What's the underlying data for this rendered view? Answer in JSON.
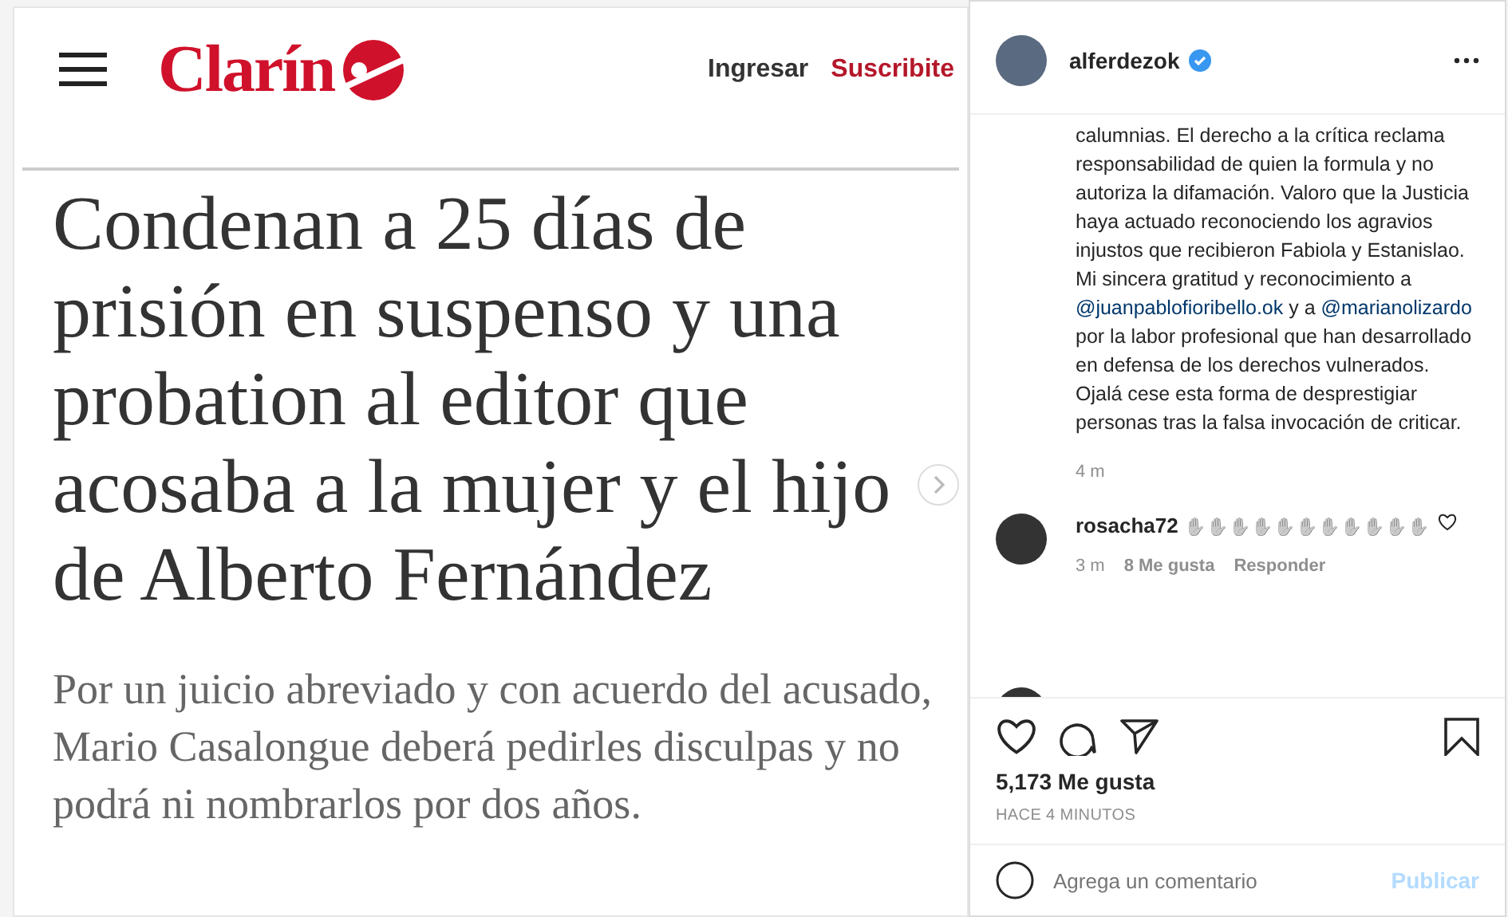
{
  "article": {
    "logo": "Clarín",
    "login": "Ingresar",
    "subscribe": "Suscribite",
    "headline": "Condenan a 25 días de prisión en suspenso y una probation al editor que acosaba a la mujer y el hijo de Alberto Fernández",
    "summary": "Por un juicio abreviado y con acuerdo del acusado, Mario Casalongue deberá pedirles disculpas y no podrá ni nombrarlos por dos años."
  },
  "post": {
    "username": "alferdezok",
    "verified": true,
    "caption": [
      {
        "kind": "text",
        "text": "calumnias. El derecho a la crítica reclama responsabilidad de quien la formula y no autoriza la difamación. Valoro que la Justicia haya actuado reconociendo los agravios injustos que recibieron Fabiola y Estanislao. Mi sincera gratitud y reconocimiento a "
      },
      {
        "kind": "mention",
        "text": "@juanpablofioribello.ok"
      },
      {
        "kind": "text",
        "text": " y a "
      },
      {
        "kind": "mention",
        "text": "@marianolizardo"
      },
      {
        "kind": "text",
        "text": " por la labor profesional que han desarrollado en defensa de los derechos vulnerados. Ojalá cese esta forma de desprestigiar personas tras la falsa invocación de criticar."
      }
    ],
    "caption_time": "4 m",
    "comments": [
      {
        "username": "rosacha72",
        "text": "✋✋✋✋✋✋✋✋✋✋✋",
        "time": "3 m",
        "likes": "8 Me gusta",
        "reply": "Responder",
        "liked": false
      }
    ],
    "likes": "5,173 Me gusta",
    "posted": "HACE 4 MINUTOS",
    "comment_placeholder": "Agrega un comentario",
    "publish": "Publicar"
  }
}
